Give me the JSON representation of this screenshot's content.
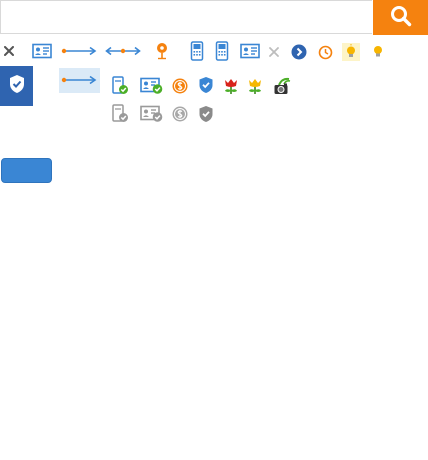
{
  "search": {
    "placeholder": "",
    "value": ""
  },
  "action_button": {
    "label": ""
  },
  "colors": {
    "accent_orange": "#f5820f",
    "primary_blue": "#2f64b0",
    "icon_blue": "#3a86d4",
    "success_green": "#4caf28",
    "disabled_gray": "#9a9a9a"
  },
  "icons": {
    "row1": [
      "close-icon",
      "id-card-icon",
      "arrow-right-icon",
      "arrow-both-icon",
      "location-pin-icon",
      "phone-icon",
      "phone-icon",
      "id-card-icon",
      "close-icon",
      "chevron-circle-right-icon",
      "clock-icon",
      "lightbulb-icon",
      "lightbulb-icon"
    ],
    "row2": [
      "shield-check-icon",
      "arrow-right-icon",
      "phone-verified-icon",
      "id-card-verified-icon",
      "coin-icon",
      "shield-check-icon",
      "flower-icon",
      "flower-icon",
      "camera-icon"
    ],
    "row3": [
      "phone-verified-icon",
      "id-card-verified-icon",
      "coin-icon",
      "shield-check-icon"
    ]
  }
}
